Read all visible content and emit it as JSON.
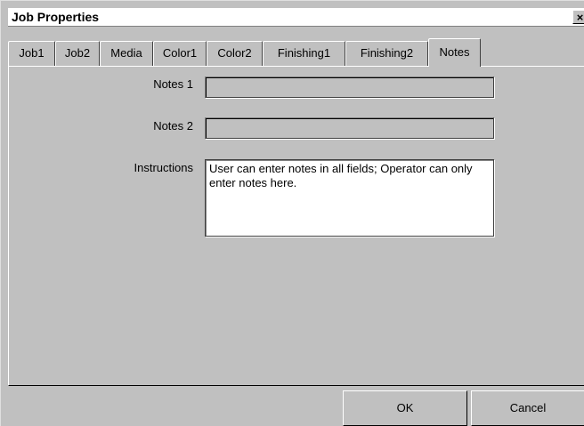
{
  "window": {
    "title": "Job Properties",
    "close_glyph": "×"
  },
  "tabs": [
    {
      "label": "Job1"
    },
    {
      "label": "Job2"
    },
    {
      "label": "Media"
    },
    {
      "label": "Color1"
    },
    {
      "label": "Color2"
    },
    {
      "label": "Finishing1"
    },
    {
      "label": "Finishing2"
    },
    {
      "label": "Notes",
      "active": true
    }
  ],
  "form": {
    "notes1_label": "Notes 1",
    "notes1_value": "",
    "notes2_label": "Notes 2",
    "notes2_value": "",
    "instructions_label": "Instructions",
    "instructions_value": "User can enter notes in all fields; Operator can only enter notes here."
  },
  "buttons": {
    "ok_label": "OK",
    "cancel_label": "Cancel"
  },
  "colors": {
    "dialog_bg": "#c0c0c0",
    "title_bg": "#ffffff",
    "input_bg": "#ffffff"
  }
}
